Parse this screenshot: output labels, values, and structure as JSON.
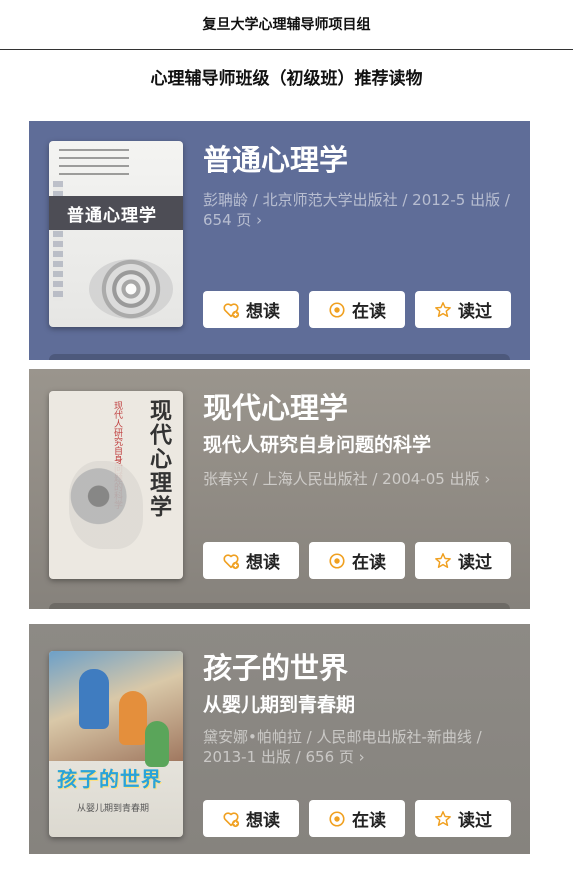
{
  "header": {
    "org": "复旦大学心理辅导师项目组"
  },
  "page": {
    "title": "心理辅导师班级（初级班）推荐读物"
  },
  "accent_color": "#f0a020",
  "books": [
    {
      "title": "普通心理学",
      "subtitle": "",
      "meta": "彭聃龄 / 北京师范大学出版社 / 2012-5 出版 / 654 页 ›",
      "cover_text": "普通心理学",
      "background": "#5f6d98"
    },
    {
      "title": "现代心理学",
      "subtitle": "现代人研究自身问题的科学",
      "meta": "张春兴 / 上海人民出版社 / 2004-05 出版 ›",
      "cover_text": "现代心理学",
      "cover_sub": "现代人研究自身问题的科学",
      "background": "#928d86"
    },
    {
      "title": "孩子的世界",
      "subtitle": "从婴儿期到青春期",
      "meta": "黛安娜•帕帕拉 / 人民邮电出版社-新曲线 / 2013-1 出版 / 656 页 ›",
      "cover_text": "孩子的世界",
      "cover_sub": "从婴儿期到青春期",
      "background": "#89867f"
    }
  ],
  "actions": {
    "want": "想读",
    "reading": "在读",
    "read": "读过"
  },
  "icons": {
    "want": "heart-plus-icon",
    "reading": "target-circle-icon",
    "read": "star-outline-icon"
  }
}
